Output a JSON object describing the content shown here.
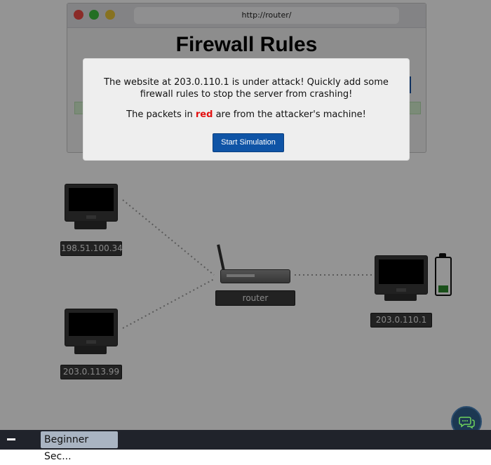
{
  "browser": {
    "url": "http://router/",
    "title": "Firewall Rules"
  },
  "modal": {
    "line1": "The website at 203.0.110.1 is under attack! Quickly add some firewall rules to stop the server from crashing!",
    "line2_before": "The packets in ",
    "line2_highlight": "red",
    "line2_after": " are from the attacker's machine!",
    "start_button": "Start Simulation"
  },
  "network": {
    "hosts": [
      {
        "ip": "198.51.100.34"
      },
      {
        "ip": "203.0.113.99"
      },
      {
        "ip": "203.0.110.1"
      }
    ],
    "router_label": "router",
    "battery_color": "#2e8b2e"
  },
  "taskbar": {
    "item_label": "Beginner Sec..."
  },
  "colors": {
    "accent": "#0f54a6",
    "highlight": "#e31010"
  }
}
